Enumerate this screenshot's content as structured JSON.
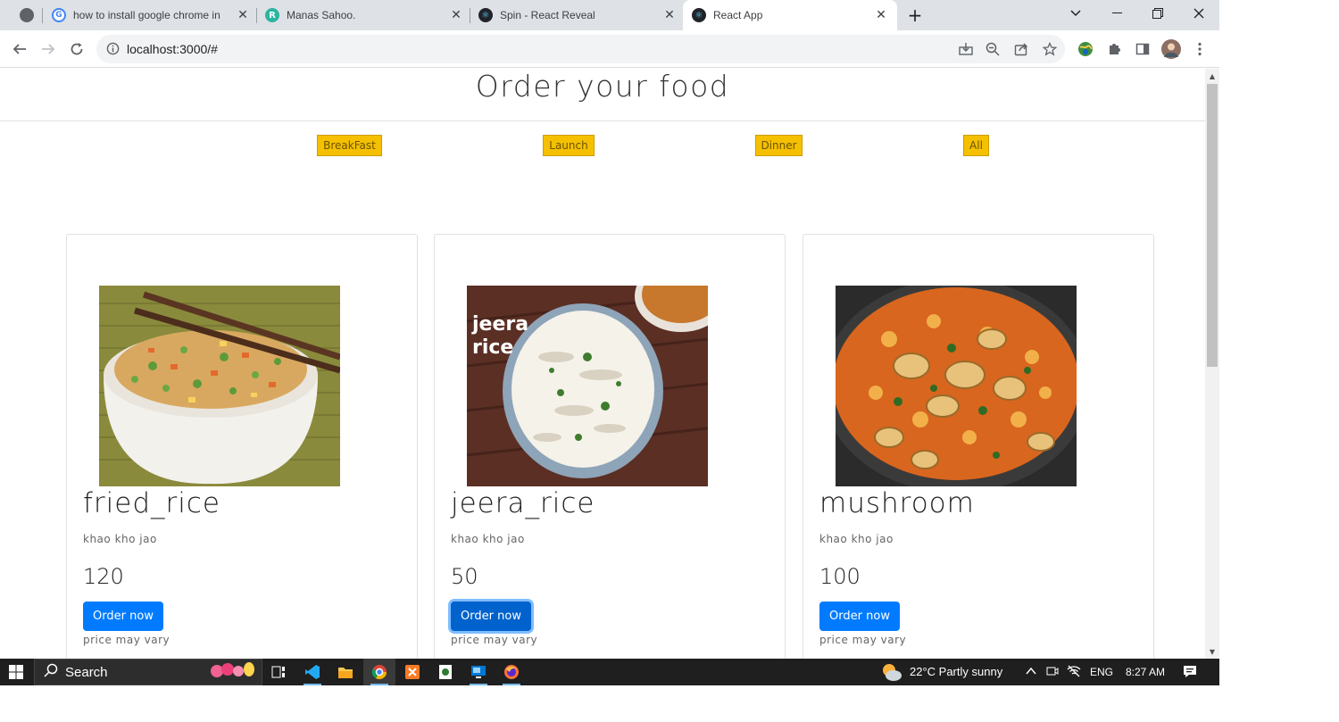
{
  "browser": {
    "tabs": [
      {
        "title": "how to install google chrome in",
        "favicon": "google-icon"
      },
      {
        "title": "Manas Sahoo.",
        "favicon": "r-letter-icon"
      },
      {
        "title": "Spin - React Reveal",
        "favicon": "react-icon"
      },
      {
        "title": "React App",
        "favicon": "react-icon",
        "active": true
      }
    ],
    "new_tab_label": "+",
    "url": "localhost:3000/#"
  },
  "page": {
    "title": "Order your food",
    "filters": [
      "BreakFast",
      "Launch",
      "Dinner",
      "All"
    ],
    "items": [
      {
        "name": "fried_rice",
        "description": "khao kho jao",
        "price": "120",
        "button": "Order now",
        "note": "price may vary"
      },
      {
        "name": "jeera_rice",
        "description": "khao kho jao",
        "price": "50",
        "button": "Order now",
        "note": "price may vary",
        "image_caption": "jeera rice"
      },
      {
        "name": "mushroom",
        "description": "khao kho jao",
        "price": "100",
        "button": "Order now",
        "note": "price may vary"
      }
    ]
  },
  "taskbar": {
    "search_label": "Search",
    "weather": "22°C  Partly sunny",
    "language": "ENG",
    "time": "8:27 AM"
  },
  "colors": {
    "filter_bg": "#f5c000",
    "primary_button": "#007bff"
  }
}
